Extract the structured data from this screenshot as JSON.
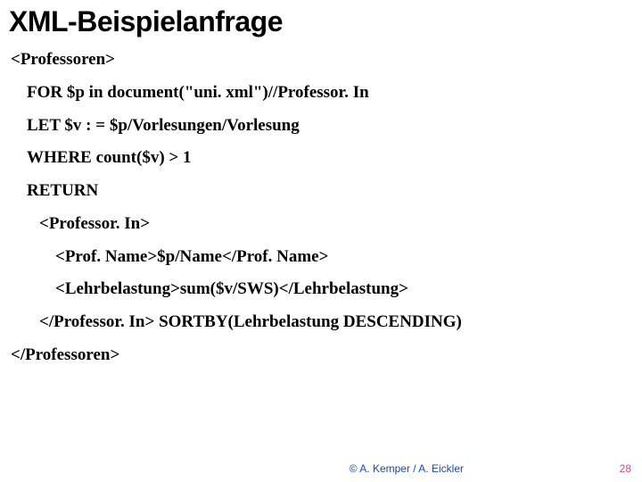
{
  "title": "XML-Beispielanfrage",
  "code": {
    "l0": "<Professoren>",
    "l1": "FOR $p in document(\"uni. xml\")//Professor. In",
    "l2": "LET $v : = $p/Vorlesungen/Vorlesung",
    "l3": "WHERE count($v) > 1",
    "l4": "RETURN",
    "l5": "<Professor. In>",
    "l6": "<Prof. Name>$p/Name</Prof. Name>",
    "l7": "<Lehrbelastung>sum($v/SWS)</Lehrbelastung>",
    "l8": "</Professor. In> SORTBY(Lehrbelastung DESCENDING)",
    "l9": "</Professoren>"
  },
  "footer": {
    "copyright": "© A. Kemper / A. Eickler",
    "page": "28"
  }
}
